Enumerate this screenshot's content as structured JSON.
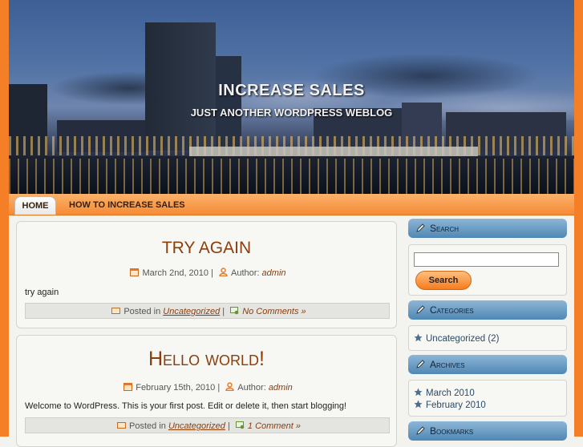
{
  "header": {
    "site_title": "INCREASE SALES",
    "site_description": "JUST ANOTHER WORDPRESS WEBLOG"
  },
  "nav": {
    "items": [
      {
        "label": "HOME"
      },
      {
        "label": "HOW TO INCREASE SALES"
      }
    ]
  },
  "posts": [
    {
      "title": "TRY AGAIN",
      "date": "March 2nd, 2010",
      "author_label": "Author:",
      "author": "admin",
      "excerpt": "try again",
      "posted_in_label": "Posted in",
      "category": "Uncategorized",
      "comments": "No Comments »"
    },
    {
      "title": "Hello world!",
      "date": "February 15th, 2010",
      "author_label": "Author:",
      "author": "admin",
      "excerpt": "Welcome to WordPress. This is your first post. Edit or delete it, then start blogging!",
      "posted_in_label": "Posted in",
      "category": "Uncategorized",
      "comments": "1 Comment »"
    }
  ],
  "sidebar": {
    "search": {
      "title": "Search",
      "button": "Search",
      "value": ""
    },
    "categories": {
      "title": "Categories",
      "items": [
        {
          "label": "Uncategorized (2)"
        }
      ]
    },
    "archives": {
      "title": "Archives",
      "items": [
        {
          "label": "March 2010"
        },
        {
          "label": "February 2010"
        }
      ]
    },
    "bookmarks": {
      "title": "Bookmarks"
    }
  },
  "colors": {
    "frame_orange": "#f47f26",
    "title_brown": "#8b3e0c",
    "widget_blue": "#4f87b4"
  }
}
